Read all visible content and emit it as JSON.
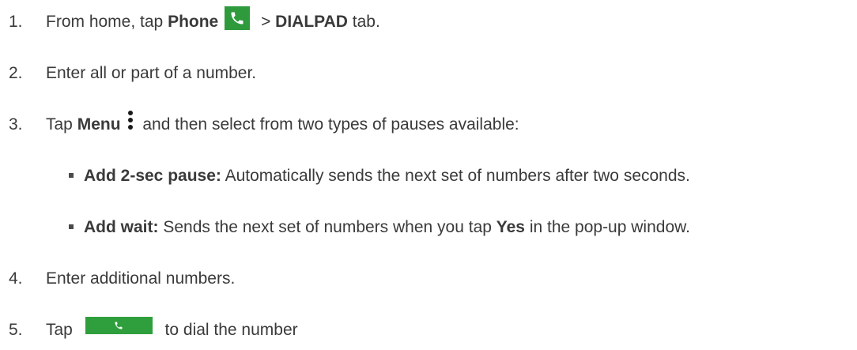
{
  "steps": [
    {
      "number": "1.",
      "text_a": "From home, tap ",
      "bold_a": "Phone",
      "text_b": " > ",
      "bold_b": "DIALPAD",
      "text_c": " tab.",
      "icon": "phone-icon"
    },
    {
      "number": "2.",
      "text_a": "Enter all or part of a number."
    },
    {
      "number": "3.",
      "text_a": "Tap ",
      "bold_a": "Menu",
      "text_b": " and then select from two types of pauses available:",
      "icon": "menu-icon"
    },
    {
      "number": "4.",
      "text_a": "Enter additional numbers."
    },
    {
      "number": "5.",
      "text_a": "Tap ",
      "text_b": " to dial the number",
      "icon": "call-button"
    }
  ],
  "bullets": [
    {
      "bold": "Add 2-sec pause:",
      "text": " Automatically sends the next set of numbers after two seconds."
    },
    {
      "bold": "Add wait:",
      "text_a": " Sends the next set of numbers when you tap ",
      "bold_b": "Yes",
      "text_b": " in the pop-up window."
    }
  ],
  "colors": {
    "text": "#3a3a3a",
    "phone_green": "#2e9a3c"
  }
}
